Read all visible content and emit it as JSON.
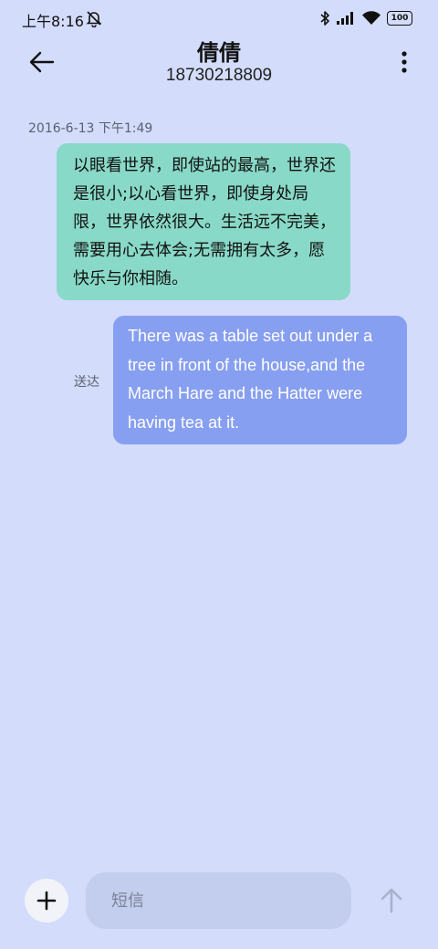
{
  "status_bar": {
    "time": "上午8:16",
    "battery": "100"
  },
  "header": {
    "contact_name": "倩倩",
    "phone_number": "18730218809"
  },
  "messages": [
    {
      "direction": "incoming",
      "timestamp": "2016-6-13 下午1:49",
      "text": "以眼看世界，即使站的最高，世界还是很小;以心看世界，即使身处局限，世界依然很大。生活远不完美，需要用心去体会;无需拥有太多，愿快乐与你相随。"
    },
    {
      "direction": "outgoing",
      "status": "送达",
      "text": "There was a table set out under a tree in front of the house,and the March Hare and the Hatter were having tea at it."
    }
  ],
  "compose": {
    "placeholder": "短信"
  },
  "colors": {
    "background": "#d3dcfb",
    "incoming_bubble": "#89d9c8",
    "outgoing_bubble": "#879ff1"
  },
  "icons": {
    "back": "arrow-left-icon",
    "more": "more-vertical-icon",
    "add": "plus-icon",
    "send": "arrow-up-icon",
    "dnd": "bell-off-icon",
    "bluetooth": "bluetooth-icon",
    "signal": "signal-icon",
    "wifi": "wifi-icon"
  }
}
